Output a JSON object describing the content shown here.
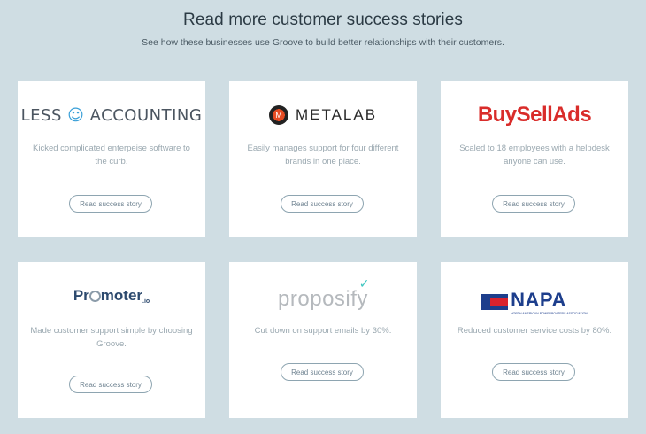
{
  "header": {
    "title": "Read more customer success stories",
    "subtitle": "See how these businesses use Groove to build better relationships with their customers."
  },
  "cards": [
    {
      "logo": {
        "left": "LESS",
        "right": "ACCOUNTING",
        "icon": "smiley-face-icon"
      },
      "description": "Kicked complicated enterpeise software to the curb.",
      "button": "Read success story"
    },
    {
      "logo": {
        "text": "METALAB",
        "icon": "metalab-badge-icon"
      },
      "description": "Easily manages support for four different brands in one place.",
      "button": "Read success story"
    },
    {
      "logo": {
        "text": "BuySellAds"
      },
      "description": "Scaled to 18 employees with a helpdesk anyone can use.",
      "button": "Read success story"
    },
    {
      "logo": {
        "a": "Pr",
        "b": "moter",
        "c": ".io",
        "icon": "megaphone-icon"
      },
      "description": "Made customer support simple by choosing Groove.",
      "button": "Read success story"
    },
    {
      "logo": {
        "text": "proposify",
        "icon": "check-icon"
      },
      "description": "Cut down on support emails by 30%.",
      "button": "Read success story"
    },
    {
      "logo": {
        "text": "NAPA",
        "tagline": "NORTH AMERICAN POWERBOATERS ASSOCIATION",
        "icon": "napa-flag-icon"
      },
      "description": "Reduced customer service costs by 80%.",
      "button": "Read success story"
    }
  ],
  "colors": {
    "background": "#cfdde3",
    "card": "#ffffff",
    "buysellads": "#d92c2a",
    "napa": "#1d3e8c",
    "proposify_check": "#3ec6c0"
  }
}
